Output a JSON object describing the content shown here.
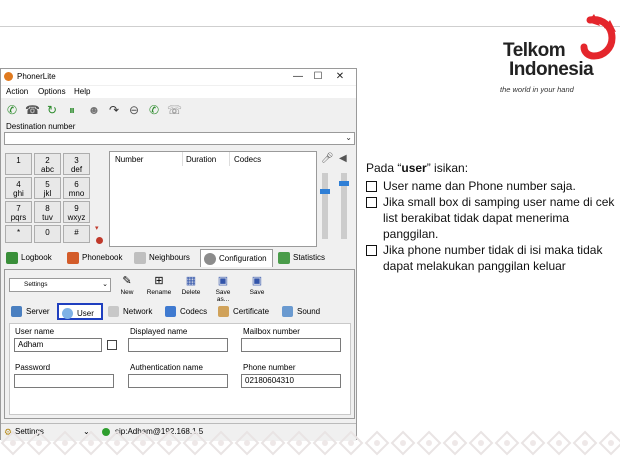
{
  "logo": {
    "line1": "Telkom",
    "line2": "Indonesia",
    "tagline": "the world in your hand"
  },
  "window": {
    "title": "PhonerLite",
    "buttons": {
      "minimize": "—",
      "maximize": "☐",
      "close": "✕"
    },
    "menu": [
      "Action",
      "Options",
      "Help"
    ],
    "destination_label": "Destination number",
    "keypad": [
      {
        "d": "1",
        "l": ""
      },
      {
        "d": "2",
        "l": "abc"
      },
      {
        "d": "3",
        "l": "def"
      },
      {
        "d": "4",
        "l": "ghi"
      },
      {
        "d": "5",
        "l": "jkl"
      },
      {
        "d": "6",
        "l": "mno"
      },
      {
        "d": "7",
        "l": "pqrs"
      },
      {
        "d": "8",
        "l": "tuv"
      },
      {
        "d": "9",
        "l": "wxyz"
      },
      {
        "d": "*",
        "l": ""
      },
      {
        "d": "0",
        "l": ""
      },
      {
        "d": "#",
        "l": ""
      }
    ],
    "call_columns": [
      "Number",
      "Duration",
      "Codecs"
    ],
    "main_tabs": [
      "Logbook",
      "Phonebook",
      "Neighbours",
      "Configuration",
      "Statistics"
    ],
    "settings_select": "Settings",
    "toolbar_buttons": [
      "New",
      "Rename",
      "Delete",
      "Save as...",
      "Save"
    ],
    "config_tabs": [
      "Server",
      "User",
      "Network",
      "Codecs",
      "Certificate",
      "Sound"
    ],
    "form": {
      "user_name_label": "User name",
      "user_name_value": "Adham",
      "displayed_name_label": "Displayed name",
      "mailbox_label": "Mailbox number",
      "password_label": "Password",
      "auth_name_label": "Authentication name",
      "phone_label": "Phone number",
      "phone_value": "02180604310"
    },
    "status": {
      "profile": "Settings",
      "sip": "sip:Adham@192.168.1.5"
    }
  },
  "notes": {
    "intro_prefix": "Pada  “",
    "intro_bold": "user",
    "intro_suffix": "” isikan:",
    "items": [
      "User name dan Phone number saja.",
      "Jika small box di samping user name di cek list berakibat tidak dapat menerima panggilan.",
      "Jika phone number tidak di isi maka tidak dapat melakukan panggilan keluar"
    ]
  },
  "colors": {
    "brand_red": "#e4262c",
    "selected_tab_border": "#1f3fbf",
    "status_green": "#2e9e2e"
  }
}
